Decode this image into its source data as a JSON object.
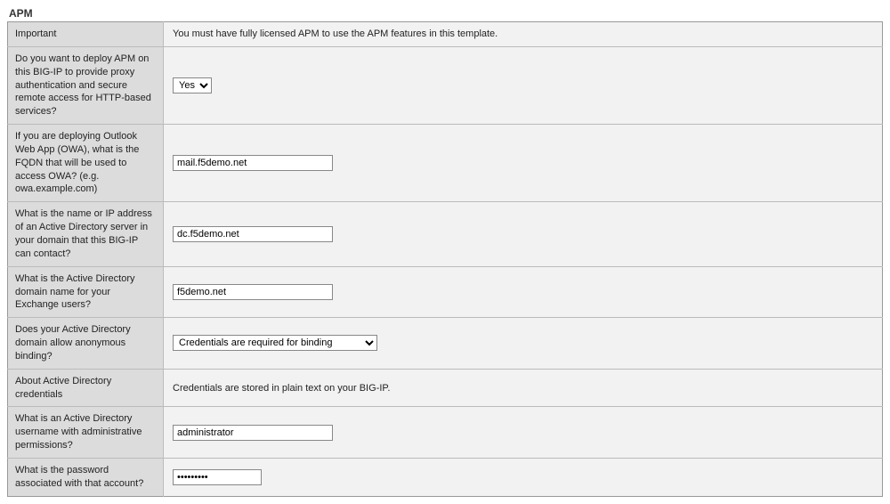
{
  "section": {
    "title": "APM"
  },
  "rows": {
    "important": {
      "label": "Important",
      "text": "You must have fully licensed APM to use the APM features in this template."
    },
    "deploy_apm": {
      "label": "Do you want to deploy APM on this BIG-IP to provide proxy authentication and secure remote access for HTTP-based services?",
      "value": "Yes"
    },
    "owa_fqdn": {
      "label": "If you are deploying Outlook Web App (OWA), what is the FQDN that will be used to access OWA? (e.g. owa.example.com)",
      "value": "mail.f5demo.net"
    },
    "ad_server": {
      "label": "What is the name or IP address of an Active Directory server in your domain that this BIG-IP can contact?",
      "value": "dc.f5demo.net"
    },
    "ad_domain": {
      "label": "What is the Active Directory domain name for your Exchange users?",
      "value": "f5demo.net"
    },
    "anon_binding": {
      "label": "Does your Active Directory domain allow anonymous binding?",
      "value": "Credentials are required for binding"
    },
    "about_creds": {
      "label": "About Active Directory credentials",
      "text": "Credentials are stored in plain text on your BIG-IP."
    },
    "ad_user": {
      "label": "What is an Active Directory username with administrative permissions?",
      "value": "administrator"
    },
    "ad_password": {
      "label": "What is the password associated with that account?",
      "value": "•••••••••"
    }
  }
}
